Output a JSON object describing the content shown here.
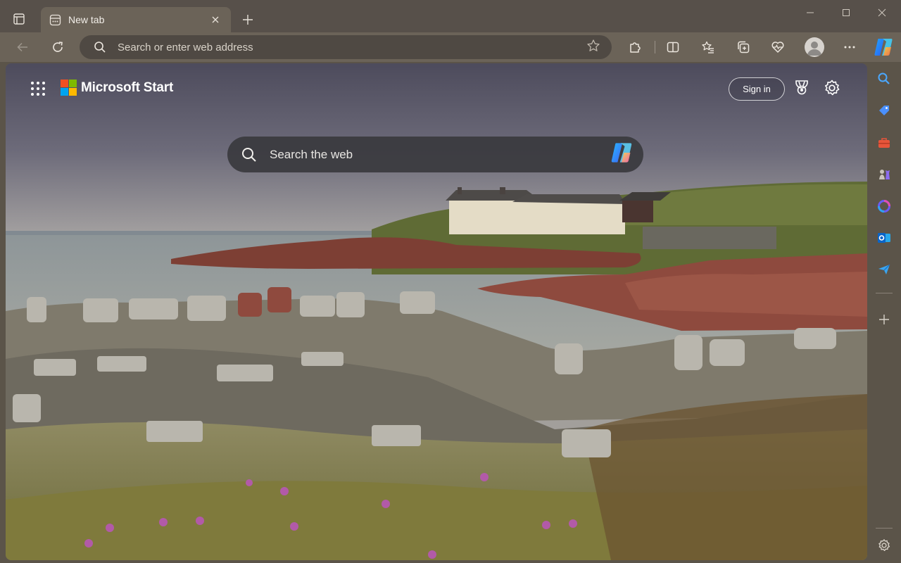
{
  "window": {
    "tab_title": "New tab"
  },
  "toolbar": {
    "address_placeholder": "Search or enter web address"
  },
  "page": {
    "brand": "Microsoft Start",
    "sign_in": "Sign in",
    "search_placeholder": "Search the web"
  },
  "icons": {
    "tab_actions": "tab-actions-icon",
    "tab_page": "new-tab-page-icon",
    "tab_close": "close-icon",
    "new_tab": "plus-icon",
    "back": "arrow-left-icon",
    "refresh": "refresh-icon",
    "search": "search-icon",
    "favorite": "star-icon",
    "extensions": "puzzle-icon",
    "split_screen": "split-screen-icon",
    "favorites": "favorites-list-icon",
    "collections": "collections-icon",
    "browser_essentials": "heart-pulse-icon",
    "profile": "profile-icon",
    "more": "more-icon",
    "copilot": "copilot-icon"
  },
  "colors": {
    "frame": "#57504a",
    "toolbar": "#6b6358",
    "address_bar": "#4f4943",
    "search_box": "#3a3a3e"
  }
}
